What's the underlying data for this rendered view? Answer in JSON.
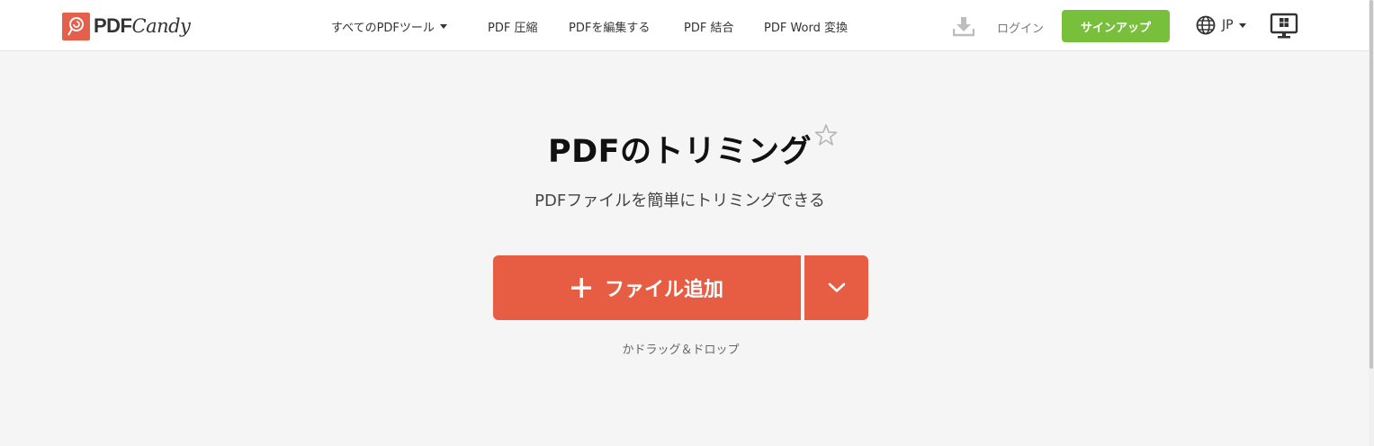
{
  "brand": {
    "logo_pdf": "PDF",
    "logo_candy": "Candy",
    "accent": "#e65d44",
    "green": "#78c03c"
  },
  "nav": {
    "all_tools": "すべてのPDFツール",
    "compress": "PDF 圧縮",
    "edit": "PDFを編集する",
    "merge": "PDF 結合",
    "word": "PDF Word 変換"
  },
  "header": {
    "login": "ログイン",
    "signup": "サインアップ",
    "language": "JP",
    "icons": [
      "download-icon",
      "globe-icon",
      "windows-desktop-icon"
    ]
  },
  "main": {
    "title": "PDFのトリミング",
    "subtitle": "PDFファイルを簡単にトリミングできる",
    "add_file": "ファイル追加",
    "drag_drop": "かドラッグ＆ドロップ",
    "icons": [
      "star-icon",
      "plus-icon",
      "chevron-down-icon"
    ]
  }
}
